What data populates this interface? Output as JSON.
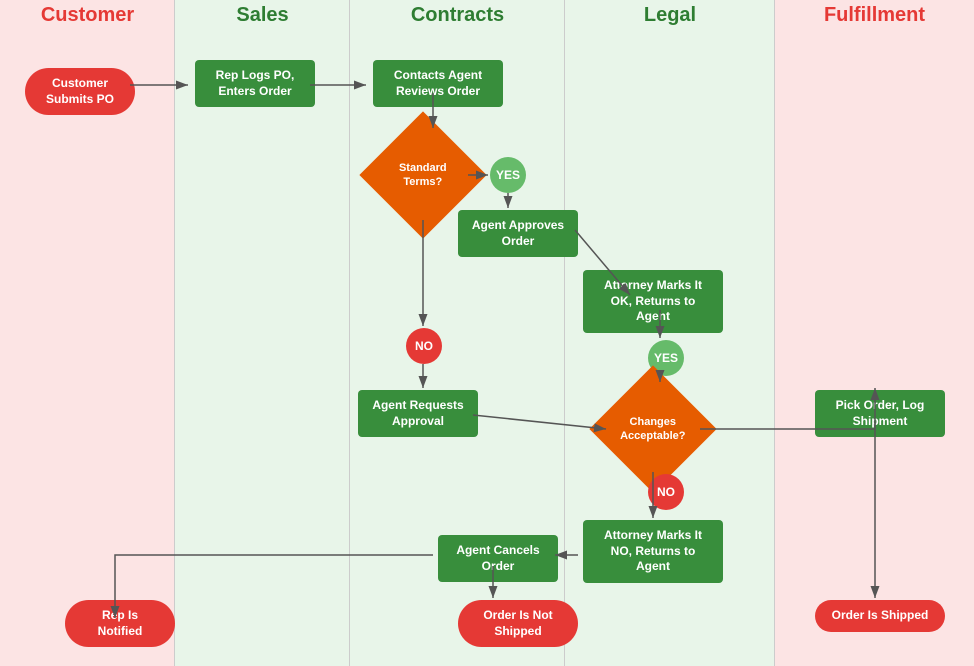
{
  "lanes": [
    {
      "id": "customer",
      "label": "Customer"
    },
    {
      "id": "sales",
      "label": "Sales"
    },
    {
      "id": "contracts",
      "label": "Contracts"
    },
    {
      "id": "legal",
      "label": "Legal"
    },
    {
      "id": "fulfillment",
      "label": "Fulfillment"
    }
  ],
  "nodes": {
    "customer_submits_po": "Customer Submits PO",
    "rep_logs_po": "Rep Logs PO,\nEnters Order",
    "contacts_agent": "Contacts Agent\nReviews Order",
    "standard_terms": "Standard\nTerms?",
    "yes_1": "YES",
    "agent_approves": "Agent Approves\nOrder",
    "attorney_marks_ok": "Attorney\nMarks It OK,\nReturns to Agent",
    "yes_2": "YES",
    "changes_acceptable": "Changes\nAcceptable?",
    "no_1": "NO",
    "agent_requests": "Agent Requests\nApproval",
    "no_2": "NO",
    "pick_order": "Pick Order,\nLog Shipment",
    "agent_cancels": "Agent Cancels\nOrder",
    "attorney_marks_no": "Attorney\nMarks It NO,\nReturns to Agent",
    "rep_notified": "Rep Is Notified",
    "order_not_shipped": "Order Is\nNot Shipped",
    "order_shipped": "Order Is Shipped"
  }
}
